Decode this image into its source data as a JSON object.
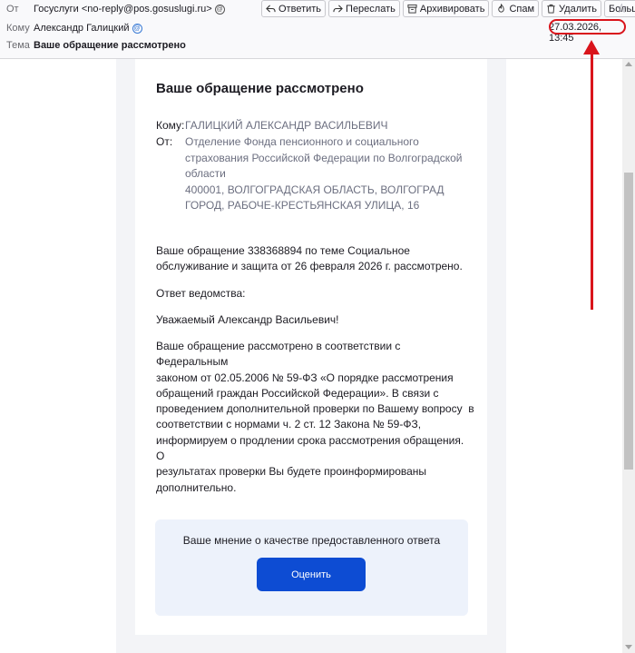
{
  "header": {
    "from_label": "От",
    "from_value": "Госуслуги <no-reply@pos.gosuslugi.ru>",
    "to_label": "Кому",
    "to_value": "Александр Галицкий",
    "subject_label": "Тема",
    "subject_value": "Ваше обращение рассмотрено",
    "date": "27.03.2026, 13:45"
  },
  "toolbar": {
    "reply": "Ответить",
    "forward": "Переслать",
    "archive": "Архивировать",
    "spam": "Спам",
    "delete": "Удалить",
    "more": "Больше"
  },
  "email": {
    "title": "Ваше обращение рассмотрено",
    "to_key": "Кому:",
    "to_val": "ГАЛИЦКИЙ АЛЕКСАНДР ВАСИЛЬЕВИЧ",
    "from_key": "От:",
    "from_lines": [
      "Отделение Фонда пенсионного и социального",
      "страхования Российской Федерации по Волгоградской",
      "области",
      "400001, ВОЛГОГРАДСКАЯ ОБЛАСТЬ, ВОЛГОГРАД",
      "ГОРОД, РАБОЧЕ-КРЕСТЬЯНСКАЯ УЛИЦА, 16"
    ],
    "p1": [
      "Ваше обращение 338368894 по теме Социальное",
      "обслуживание и защита от 26 февраля 2026 г. рассмотрено."
    ],
    "p2": "Ответ ведомства:",
    "p3": "Уважаемый Александр Васильевич!",
    "p4": [
      "Ваше обращение рассмотрено в соответствии с Федеральным",
      "законом от 02.05.2006 № 59-ФЗ «О порядке рассмотрения",
      "обращений граждан Российской Федерации». В связи с",
      "проведением дополнительной проверки по Вашему вопросу  в",
      "соответствии с нормами ч. 2 ст. 12 Закона № 59-ФЗ,",
      "информируем о продлении срока рассмотрения обращения. О",
      "результатах проверки Вы будете проинформированы",
      "дополнительно."
    ],
    "rating_text": "Ваше мнение о качестве предоставленного ответа",
    "rating_button": "Оценить"
  },
  "icons": {
    "reply": "reply-arrow-icon",
    "forward": "forward-arrow-icon",
    "archive": "archive-box-icon",
    "spam": "spam-flame-icon",
    "delete": "trash-icon",
    "more": "chevron-down-icon",
    "star": "star-icon"
  },
  "colors": {
    "accent_button": "#0d4cd3",
    "annotation_red": "#d9141b",
    "meta_gray": "#6c6f80"
  }
}
